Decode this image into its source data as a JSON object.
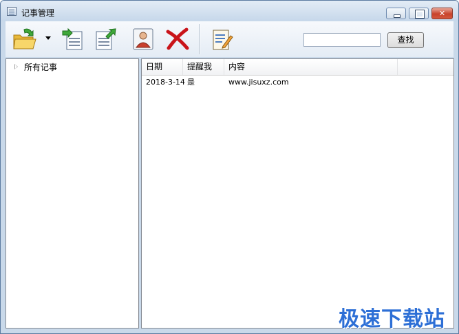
{
  "window": {
    "title": "记事管理"
  },
  "toolbar": {
    "buttons": [
      {
        "name": "open-folder-icon"
      },
      {
        "name": "import-icon"
      },
      {
        "name": "export-icon"
      },
      {
        "name": "user-icon"
      },
      {
        "name": "delete-icon"
      },
      {
        "name": "edit-note-icon"
      }
    ],
    "search_value": "",
    "search_label": "查找"
  },
  "tree": {
    "items": [
      {
        "label": "所有记事"
      }
    ]
  },
  "list": {
    "columns": [
      "日期",
      "提醒我",
      "内容"
    ],
    "rows": [
      [
        "2018-3-14",
        "是",
        "www.jisuxz.com"
      ]
    ]
  },
  "watermark": "极速下载站",
  "colors": {
    "accent": "#2d6fd6",
    "titlebar": "#c6d7ea",
    "close": "#c8422b"
  }
}
